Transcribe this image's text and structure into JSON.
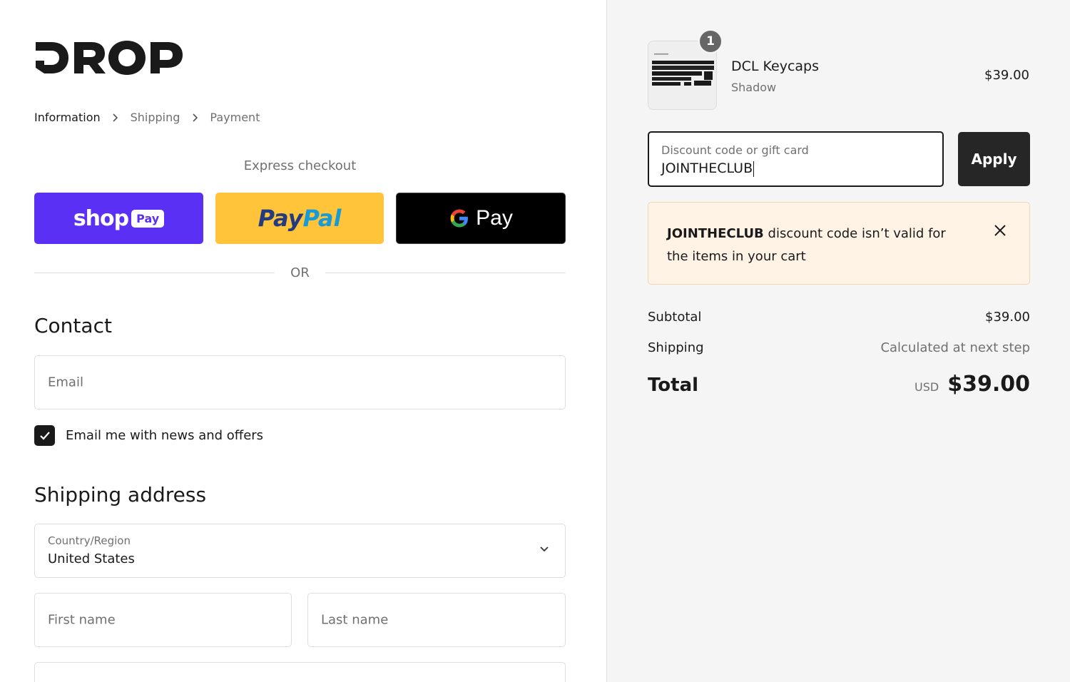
{
  "brand": {
    "logo_text": "DROP"
  },
  "breadcrumb": {
    "items": [
      "Information",
      "Shipping",
      "Payment"
    ]
  },
  "express": {
    "label": "Express checkout",
    "shop_pay": {
      "word": "shop",
      "badge": "Pay",
      "color": "#5a31f4"
    },
    "paypal": {
      "part1": "Pay",
      "part2": "Pal",
      "color": "#ffc439"
    },
    "google_pay": {
      "word": "Pay",
      "color": "#000000"
    }
  },
  "divider": {
    "text": "OR"
  },
  "contact": {
    "heading": "Contact",
    "email_placeholder": "Email",
    "newsletter_label": "Email me with news and offers",
    "newsletter_checked": true
  },
  "shipping": {
    "heading": "Shipping address",
    "country_label": "Country/Region",
    "country_value": "United States",
    "first_name_placeholder": "First name",
    "last_name_placeholder": "Last name"
  },
  "cart": {
    "item": {
      "quantity": "1",
      "name": "DCL Keycaps",
      "variant": "Shadow",
      "price": "$39.00"
    },
    "discount": {
      "label": "Discount code or gift card",
      "value": "JOINTHECLUB",
      "apply_label": "Apply"
    },
    "alert": {
      "code": "JOINTHECLUB",
      "message": "discount code isn’t valid for the items in your cart"
    },
    "summary": {
      "subtotal_label": "Subtotal",
      "subtotal_value": "$39.00",
      "shipping_label": "Shipping",
      "shipping_value": "Calculated at next step",
      "total_label": "Total",
      "total_currency": "USD",
      "total_value": "$39.00"
    }
  }
}
